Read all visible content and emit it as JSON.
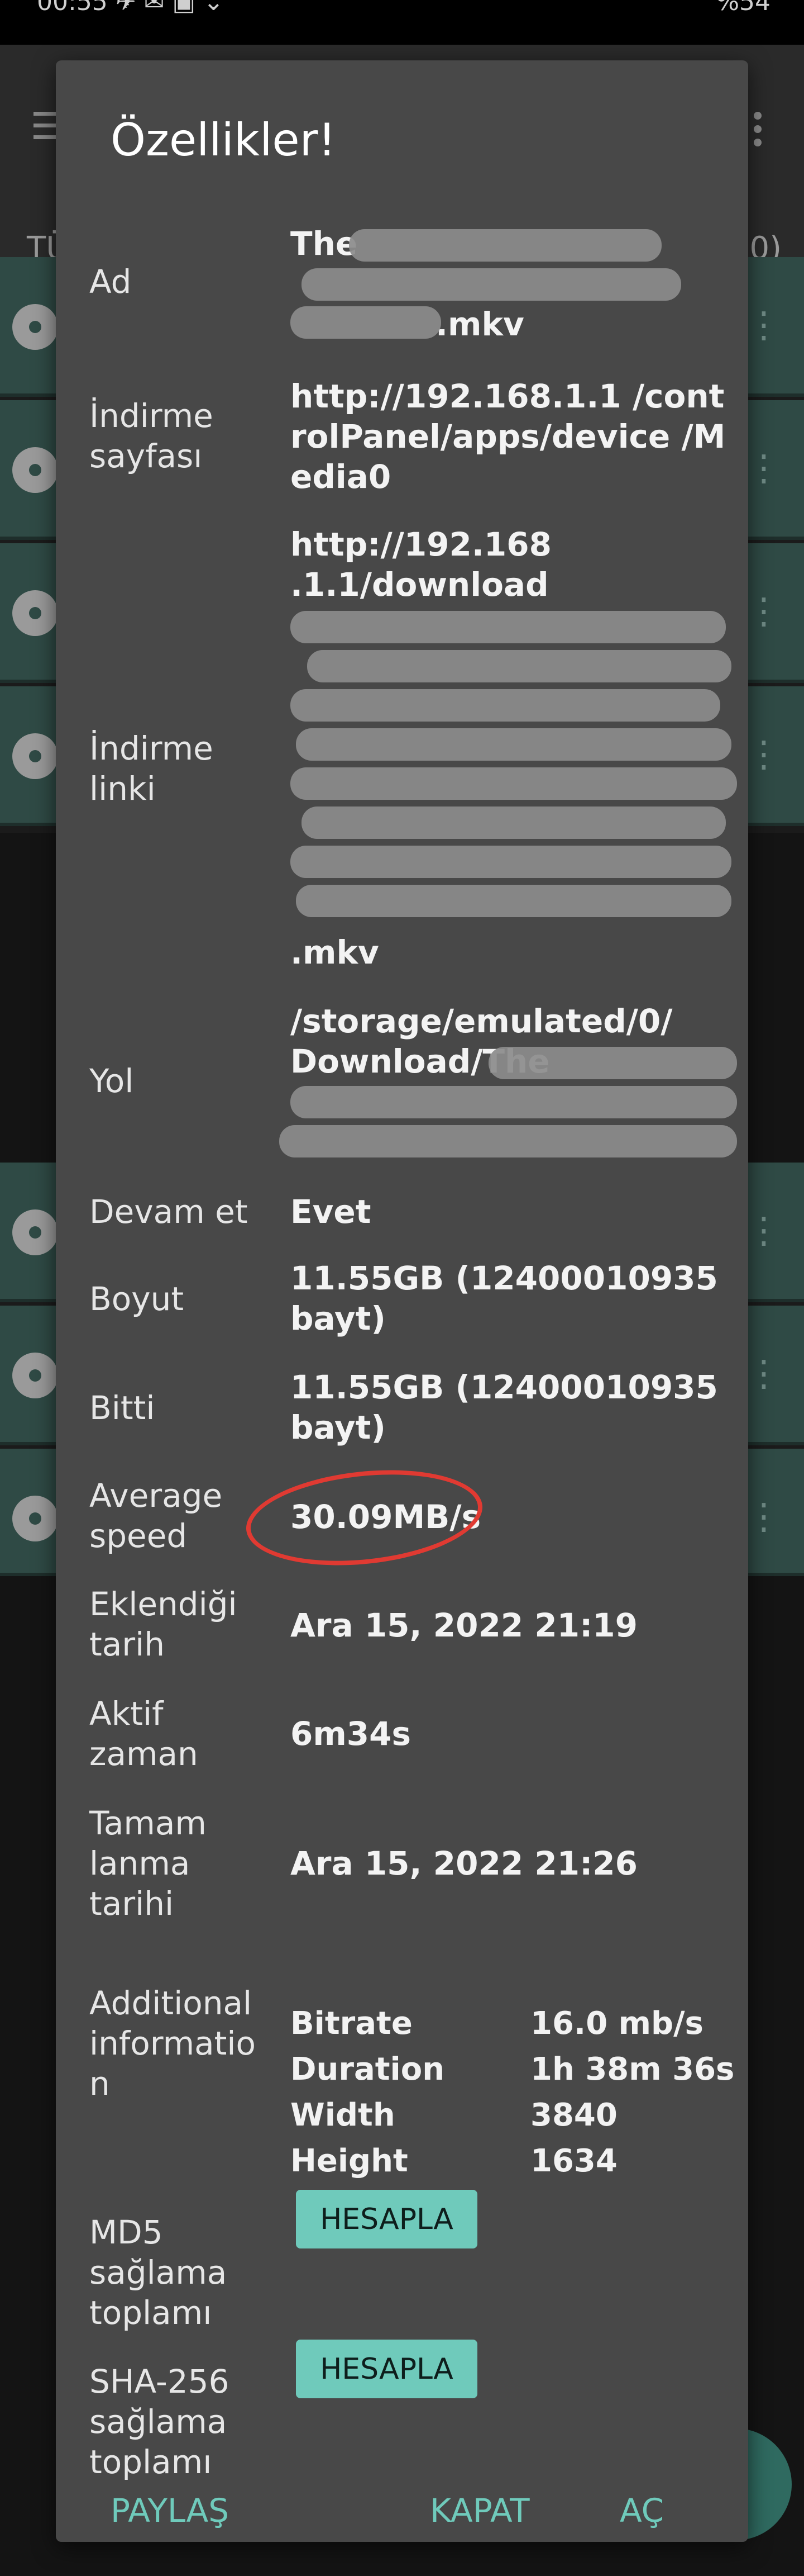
{
  "status_bar": {
    "time": "00:55 ✈ ✉ ▣ ⌄",
    "battery": "%54"
  },
  "background": {
    "tab_left": "TÜ",
    "tab_right": "0)"
  },
  "dialog": {
    "title": "Özellikler!",
    "labels": {
      "name": "Ad",
      "page": "İndirme sayfası",
      "link": "İndirme linki",
      "path": "Yol",
      "resume": "Devam et",
      "size": "Boyut",
      "done": "Bitti",
      "speed": "Average speed",
      "added": "Eklendiği tarih",
      "active": "Aktif zaman",
      "completed": "Tamam lanma tarihi",
      "additional": "Additional informatio n",
      "md5": "MD5 sağlama toplamı",
      "sha": "SHA-256 sağlama toplamı"
    },
    "values": {
      "name_l1": "The",
      "name_l3": ".mkv",
      "page": "http://192.168.1.1 /controlPanel/apps/device /Media0",
      "link_l1": "http://192.168",
      "link_l2": ".1.1/download",
      "link_last": ".mkv",
      "path_l1": "/storage/emulated/0/",
      "path_l2": "Download/The",
      "resume": "Evet",
      "size": "11.55GB (12400010935 bayt)",
      "done": "11.55GB (12400010935 bayt)",
      "speed": "30.09MB/s",
      "added": "Ara 15, 2022 21:19",
      "active": "6m34s",
      "completed": "Ara 15, 2022 21:26"
    },
    "info": [
      {
        "key": "Bitrate",
        "value": "16.0 mb/s"
      },
      {
        "key": "Duration",
        "value": "1h 38m 36s"
      },
      {
        "key": "Width",
        "value": "3840"
      },
      {
        "key": "Height",
        "value": "1634"
      }
    ],
    "md5_button": "HESAPLA",
    "sha_button": "HESAPLA",
    "actions": {
      "share": "PAYLAŞ",
      "close": "KAPAT",
      "open": "AÇ"
    }
  }
}
